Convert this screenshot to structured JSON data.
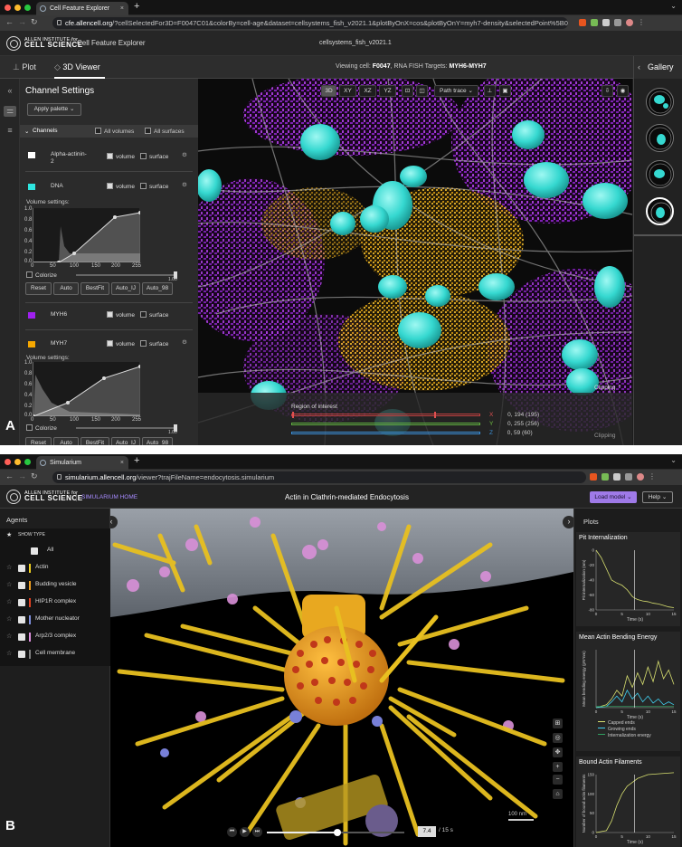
{
  "panelA": {
    "label": "A",
    "tab_title": "Cell Feature Explorer",
    "url_domain": "cfe.allencell.org",
    "url_rest": "/?cellSelectedFor3D=F0047C01&colorBy=cell-age&dataset=cellsystems_fish_v2021.1&plotByOnX=cos&plotByOnY=myh7-density&selectedPoint%5B0%5D=F0469C07&selectedP...",
    "org_small": "ALLEN INSTITUTE for",
    "org_big": "CELL SCIENCE",
    "app_name": "Cell Feature Explorer",
    "dataset": "cellsystems_fish_v2021.1",
    "tabs": {
      "plot": "Plot",
      "viewer": "3D Viewer",
      "plot_icon": "chart-icon",
      "viewer_icon": "cube-icon"
    },
    "viewing": {
      "prefix": "Viewing cell: ",
      "cell": "F0047",
      "mid": ", RNA FISH Targets: ",
      "targets": "MYH6-MYH7"
    },
    "gallery": "Gallery",
    "channel_settings": "Channel Settings",
    "apply_palette": "Apply palette",
    "channels_label": "Channels",
    "all_volumes": "All volumes",
    "all_surfaces": "All surfaces",
    "channels": [
      {
        "name": "Alpha-actinin-2",
        "color": "#ffffff",
        "volume": "volume",
        "surface": "surface"
      },
      {
        "name": "DNA",
        "color": "#2ee6e0",
        "volume": "volume",
        "surface": "surface"
      },
      {
        "name": "MYH6",
        "color": "#a020f0",
        "volume": "volume",
        "surface": "surface"
      },
      {
        "name": "MYH7",
        "color": "#f5a700",
        "volume": "volume",
        "surface": "surface"
      }
    ],
    "volume_settings": "Volume settings:",
    "yticks": [
      "1.0",
      "0.8",
      "0.6",
      "0.4",
      "0.2",
      "0.0"
    ],
    "xticks": [
      "0",
      "50",
      "100",
      "150",
      "200",
      "255"
    ],
    "colorize": "Colorize",
    "slider_val": "1.00",
    "presets": [
      "Reset",
      "Auto",
      "BestFit",
      "Auto_IJ",
      "Auto_98"
    ],
    "view_buttons": [
      "3D",
      "XY",
      "XZ",
      "YZ"
    ],
    "path_trace": "Path trace",
    "roi": {
      "title": "Region of interest",
      "clipping": "Clipping",
      "axes": [
        {
          "ax": "X",
          "val": "0, 194 (195)",
          "color": "#e05050"
        },
        {
          "ax": "Y",
          "val": "0, 255 (256)",
          "color": "#70c040"
        },
        {
          "ax": "Z",
          "val": "0, 59 (60)",
          "color": "#3a8fd8"
        }
      ]
    }
  },
  "panelB": {
    "label": "B",
    "tab_title": "Simularium",
    "url_domain": "simularium.allencell.org",
    "url_rest": "/viewer?trajFileName=endocytosis.simularium",
    "org_small": "ALLEN INSTITUTE for",
    "org_big": "CELL SCIENCE",
    "home": "SIMULARIUM HOME",
    "title": "Actin in Clathrin-mediated Endocytosis",
    "load_model": "Load model",
    "help": "Help",
    "agents_title": "Agents",
    "show_type": "SHOW TYPE",
    "all": "All",
    "agents": [
      {
        "name": "Actin",
        "color": "#f0d020"
      },
      {
        "name": "Budding vesicle",
        "color": "#f0a020"
      },
      {
        "name": "HIP1R complex",
        "color": "#e04020"
      },
      {
        "name": "Mother nucleator",
        "color": "#8090e0"
      },
      {
        "name": "Arp2/3 complex",
        "color": "#e090e0"
      },
      {
        "name": "Cell membrane",
        "color": "#808080"
      }
    ],
    "plots_title": "Plots",
    "time_current": "7.4",
    "time_total": "15 s",
    "scale": "100 nm",
    "chart_data": [
      {
        "type": "line",
        "title": "Pit Internalization",
        "xlabel": "Time (s)",
        "ylabel": "Pit internalization (nm)",
        "ylim": [
          -80,
          0
        ],
        "xlim": [
          0,
          15
        ],
        "xticks": [
          "0",
          "5",
          "10",
          "15"
        ],
        "yticks": [
          "0",
          "-20",
          "-40",
          "-60",
          "-80"
        ],
        "series": [
          {
            "x": [
              0,
              1,
              2,
              3,
              4,
              5,
              6,
              7,
              7.4,
              8,
              9,
              10,
              11,
              12,
              13,
              14,
              15
            ],
            "values": [
              0,
              -10,
              -25,
              -40,
              -44,
              -47,
              -53,
              -62,
              -64,
              -66,
              -68,
              -69,
              -71,
              -72,
              -74,
              -76,
              -77
            ],
            "color": "#d8e070"
          }
        ],
        "marker_x": 7.4
      },
      {
        "type": "line",
        "title": "Mean Actin Bending Energy",
        "xlabel": "Time (s)",
        "ylabel": "Mean bending energy (pN*nm)",
        "ylim": [
          0,
          1
        ],
        "xlim": [
          0,
          15
        ],
        "xticks": [
          "0",
          "5",
          "10",
          "15"
        ],
        "yticks": [],
        "series": [
          {
            "name": "Capped ends",
            "x": [
              0,
              2,
              3,
              4,
              5,
              6,
              7,
              8,
              9,
              10,
              11,
              12,
              13,
              14,
              15
            ],
            "values": [
              0,
              0.05,
              0.15,
              0.3,
              0.2,
              0.55,
              0.35,
              0.6,
              0.4,
              0.7,
              0.45,
              0.8,
              0.5,
              0.65,
              0.4
            ],
            "color": "#d8e070"
          },
          {
            "name": "Growing ends",
            "x": [
              0,
              2,
              3,
              4,
              5,
              6,
              7,
              8,
              9,
              10,
              11,
              12,
              13,
              14,
              15
            ],
            "values": [
              0,
              0.02,
              0.1,
              0.2,
              0.1,
              0.3,
              0.15,
              0.25,
              0.1,
              0.2,
              0.08,
              0.15,
              0.05,
              0.1,
              0.05
            ],
            "color": "#40d0f0"
          },
          {
            "name": "Internalization energy",
            "x": [
              0,
              5,
              10,
              15
            ],
            "values": [
              0.02,
              0.02,
              0.02,
              0.02
            ],
            "color": "#30a060"
          }
        ],
        "marker_x": 7.4
      },
      {
        "type": "line",
        "title": "Bound Actin Filaments",
        "xlabel": "Time (s)",
        "ylabel": "Number of bound actin filaments",
        "ylim": [
          0,
          150
        ],
        "xlim": [
          0,
          15
        ],
        "xticks": [
          "0",
          "5",
          "10",
          "15"
        ],
        "yticks": [
          "150",
          "100",
          "50",
          "0"
        ],
        "series": [
          {
            "x": [
              0,
              2,
              3,
              4,
              5,
              6,
              7,
              8,
              9,
              10,
              12,
              15
            ],
            "values": [
              0,
              5,
              30,
              70,
              100,
              120,
              130,
              140,
              145,
              150,
              152,
              155
            ],
            "color": "#d8e070"
          }
        ],
        "marker_x": 7.4
      }
    ]
  }
}
